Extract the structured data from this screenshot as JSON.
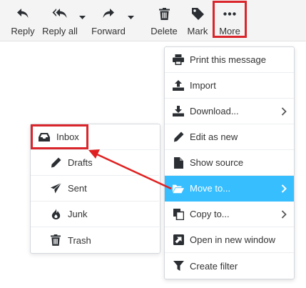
{
  "toolbar": {
    "reply": {
      "label": "Reply",
      "icon": "reply-icon"
    },
    "reply_all": {
      "label": "Reply all",
      "icon": "reply-all-icon"
    },
    "forward": {
      "label": "Forward",
      "icon": "forward-icon"
    },
    "delete": {
      "label": "Delete",
      "icon": "trash-icon"
    },
    "mark": {
      "label": "Mark",
      "icon": "tag-icon"
    },
    "more": {
      "label": "More",
      "icon": "ellipsis-icon"
    }
  },
  "more_menu": {
    "items": [
      {
        "label": "Print this message",
        "icon": "print-icon"
      },
      {
        "label": "Import",
        "icon": "upload-icon"
      },
      {
        "label": "Download...",
        "icon": "download-icon",
        "has_submenu": true
      },
      {
        "label": "Edit as new",
        "icon": "pencil-icon"
      },
      {
        "label": "Show source",
        "icon": "file-icon"
      },
      {
        "label": "Move to...",
        "icon": "folder-open-icon",
        "has_submenu": true,
        "active": true
      },
      {
        "label": "Copy to...",
        "icon": "copy-icon",
        "has_submenu": true
      },
      {
        "label": "Open in new window",
        "icon": "external-window-icon"
      },
      {
        "label": "Create filter",
        "icon": "filter-icon"
      }
    ]
  },
  "folder_menu": {
    "items": [
      {
        "label": "Inbox",
        "icon": "inbox-icon"
      },
      {
        "label": "Drafts",
        "icon": "pencil-icon"
      },
      {
        "label": "Sent",
        "icon": "paper-plane-icon"
      },
      {
        "label": "Junk",
        "icon": "fire-icon"
      },
      {
        "label": "Trash",
        "icon": "trash-icon"
      }
    ]
  },
  "colors": {
    "active_bg": "#37beff",
    "highlight_red": "#d9252b",
    "icon_dark": "#2b2f33"
  }
}
